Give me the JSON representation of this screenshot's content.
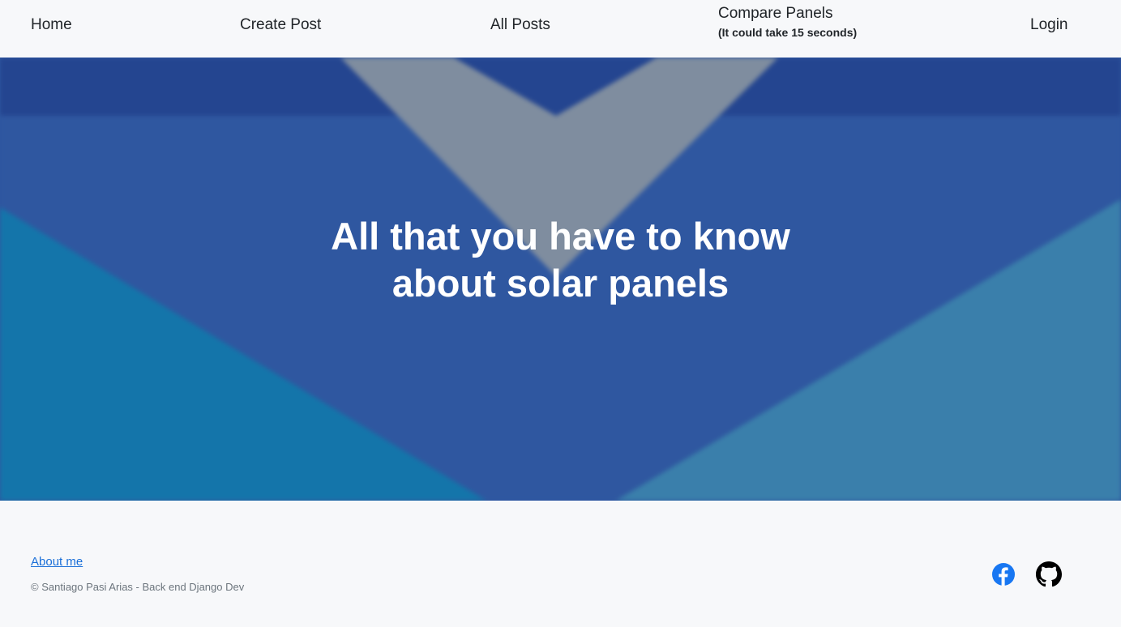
{
  "nav": {
    "home": "Home",
    "create_post": "Create Post",
    "all_posts": "All Posts",
    "compare_panels": "Compare Panels",
    "compare_note": "(It could take 15 seconds)",
    "login": "Login"
  },
  "hero": {
    "title_line1": "All that you have to know",
    "title_line2": "about solar panels"
  },
  "footer": {
    "about": "About me",
    "copyright": "© Santiago Pasi Arias - Back end Django Dev",
    "icons": [
      "facebook-icon",
      "github-icon"
    ]
  },
  "colors": {
    "link": "#1a6fd8",
    "hero_blue": "#2f57a0",
    "hero_teal": "#1475aa",
    "facebook": "#1877f2"
  }
}
